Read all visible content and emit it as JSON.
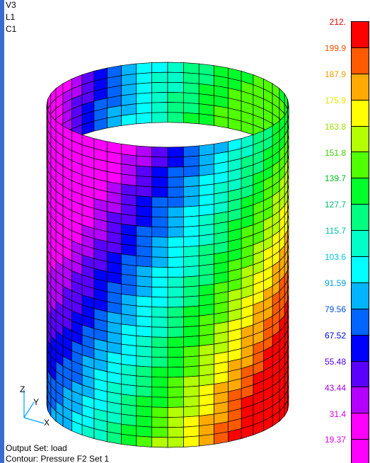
{
  "view_info": {
    "lines": [
      "V3",
      "L1",
      "C1"
    ]
  },
  "legend": {
    "entries": [
      {
        "label": "212.",
        "color": "#ff0000",
        "text_color": "#e00000"
      },
      {
        "label": "199.9",
        "color": "#ff5a00",
        "text_color": "#ff5000"
      },
      {
        "label": "187.9",
        "color": "#ffaa00",
        "text_color": "#f0a000"
      },
      {
        "label": "175.9",
        "color": "#ffff00",
        "text_color": "#e6e600"
      },
      {
        "label": "163.8",
        "color": "#b4ff00",
        "text_color": "#a0e000"
      },
      {
        "label": "151.8",
        "color": "#50ff00",
        "text_color": "#40d000"
      },
      {
        "label": "139.7",
        "color": "#00ff2a",
        "text_color": "#00c020"
      },
      {
        "label": "127.7",
        "color": "#00ff80",
        "text_color": "#00c070"
      },
      {
        "label": "115.7",
        "color": "#00ffc8",
        "text_color": "#00c0a0"
      },
      {
        "label": "103.6",
        "color": "#00ffff",
        "text_color": "#00c8d8"
      },
      {
        "label": "91.59",
        "color": "#00b4ff",
        "text_color": "#00a0e0"
      },
      {
        "label": "79.56",
        "color": "#0064ff",
        "text_color": "#0050e0"
      },
      {
        "label": "67.52",
        "color": "#0000ff",
        "text_color": "#0000e0"
      },
      {
        "label": "55.48",
        "color": "#5a00ff",
        "text_color": "#5000e0"
      },
      {
        "label": "43.44",
        "color": "#b400ff",
        "text_color": "#a000e0"
      },
      {
        "label": "31.4",
        "color": "#ff00ff",
        "text_color": "#e000e0"
      },
      {
        "label": "19.37",
        "color": "#ff00ff",
        "text_color": "#e000e0"
      }
    ]
  },
  "triad": {
    "z_label": "Z",
    "y_label": "Y",
    "x_label": "X"
  },
  "footer": {
    "output_set": "Output Set: load",
    "contour": "Contour: Pressure F2 Set 1"
  },
  "model": {
    "description_colors": {
      "edge": "#000000"
    }
  }
}
